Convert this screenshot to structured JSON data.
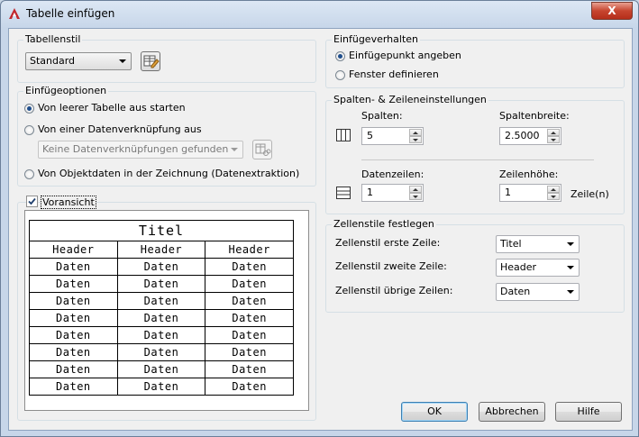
{
  "window": {
    "title": "Tabelle einfügen",
    "close_label": "X"
  },
  "tabellenstil": {
    "group_label": "Tabellenstil",
    "selected": "Standard"
  },
  "einfuegeoptionen": {
    "group_label": "Einfügeoptionen",
    "option_leer": "Von leerer Tabelle aus starten",
    "option_daten": "Von einer Datenverknüpfung aus",
    "daten_combo": "Keine Datenverknüpfungen gefunden",
    "option_objekt": "Von Objektdaten in der Zeichnung (Datenextraktion)"
  },
  "voransicht": {
    "label": "Voransicht",
    "checked": true,
    "title": "Titel",
    "headers": [
      "Header",
      "Header",
      "Header"
    ],
    "rows": [
      [
        "Daten",
        "Daten",
        "Daten"
      ],
      [
        "Daten",
        "Daten",
        "Daten"
      ],
      [
        "Daten",
        "Daten",
        "Daten"
      ],
      [
        "Daten",
        "Daten",
        "Daten"
      ],
      [
        "Daten",
        "Daten",
        "Daten"
      ],
      [
        "Daten",
        "Daten",
        "Daten"
      ],
      [
        "Daten",
        "Daten",
        "Daten"
      ],
      [
        "Daten",
        "Daten",
        "Daten"
      ]
    ]
  },
  "einfuegeverhalten": {
    "group_label": "Einfügeverhalten",
    "option_punkt": "Einfügepunkt angeben",
    "option_fenster": "Fenster definieren"
  },
  "spalten_zeilen": {
    "group_label": "Spalten- & Zeileneinstellungen",
    "spalten_label": "Spalten:",
    "spalten_value": "5",
    "spaltenbreite_label": "Spaltenbreite:",
    "spaltenbreite_value": "2.5000",
    "datenzeilen_label": "Datenzeilen:",
    "datenzeilen_value": "1",
    "zeilenhoehe_label": "Zeilenhöhe:",
    "zeilenhoehe_value": "1",
    "zeilenhoehe_unit": "Zeile(n)"
  },
  "zellenstile": {
    "group_label": "Zellenstile festlegen",
    "erste_label": "Zellenstil erste Zeile:",
    "erste_value": "Titel",
    "zweite_label": "Zellenstil zweite Zeile:",
    "zweite_value": "Header",
    "uebrige_label": "Zellenstil übrige Zeilen:",
    "uebrige_value": "Daten"
  },
  "buttons": {
    "ok": "OK",
    "abbrechen": "Abbrechen",
    "hilfe": "Hilfe"
  }
}
